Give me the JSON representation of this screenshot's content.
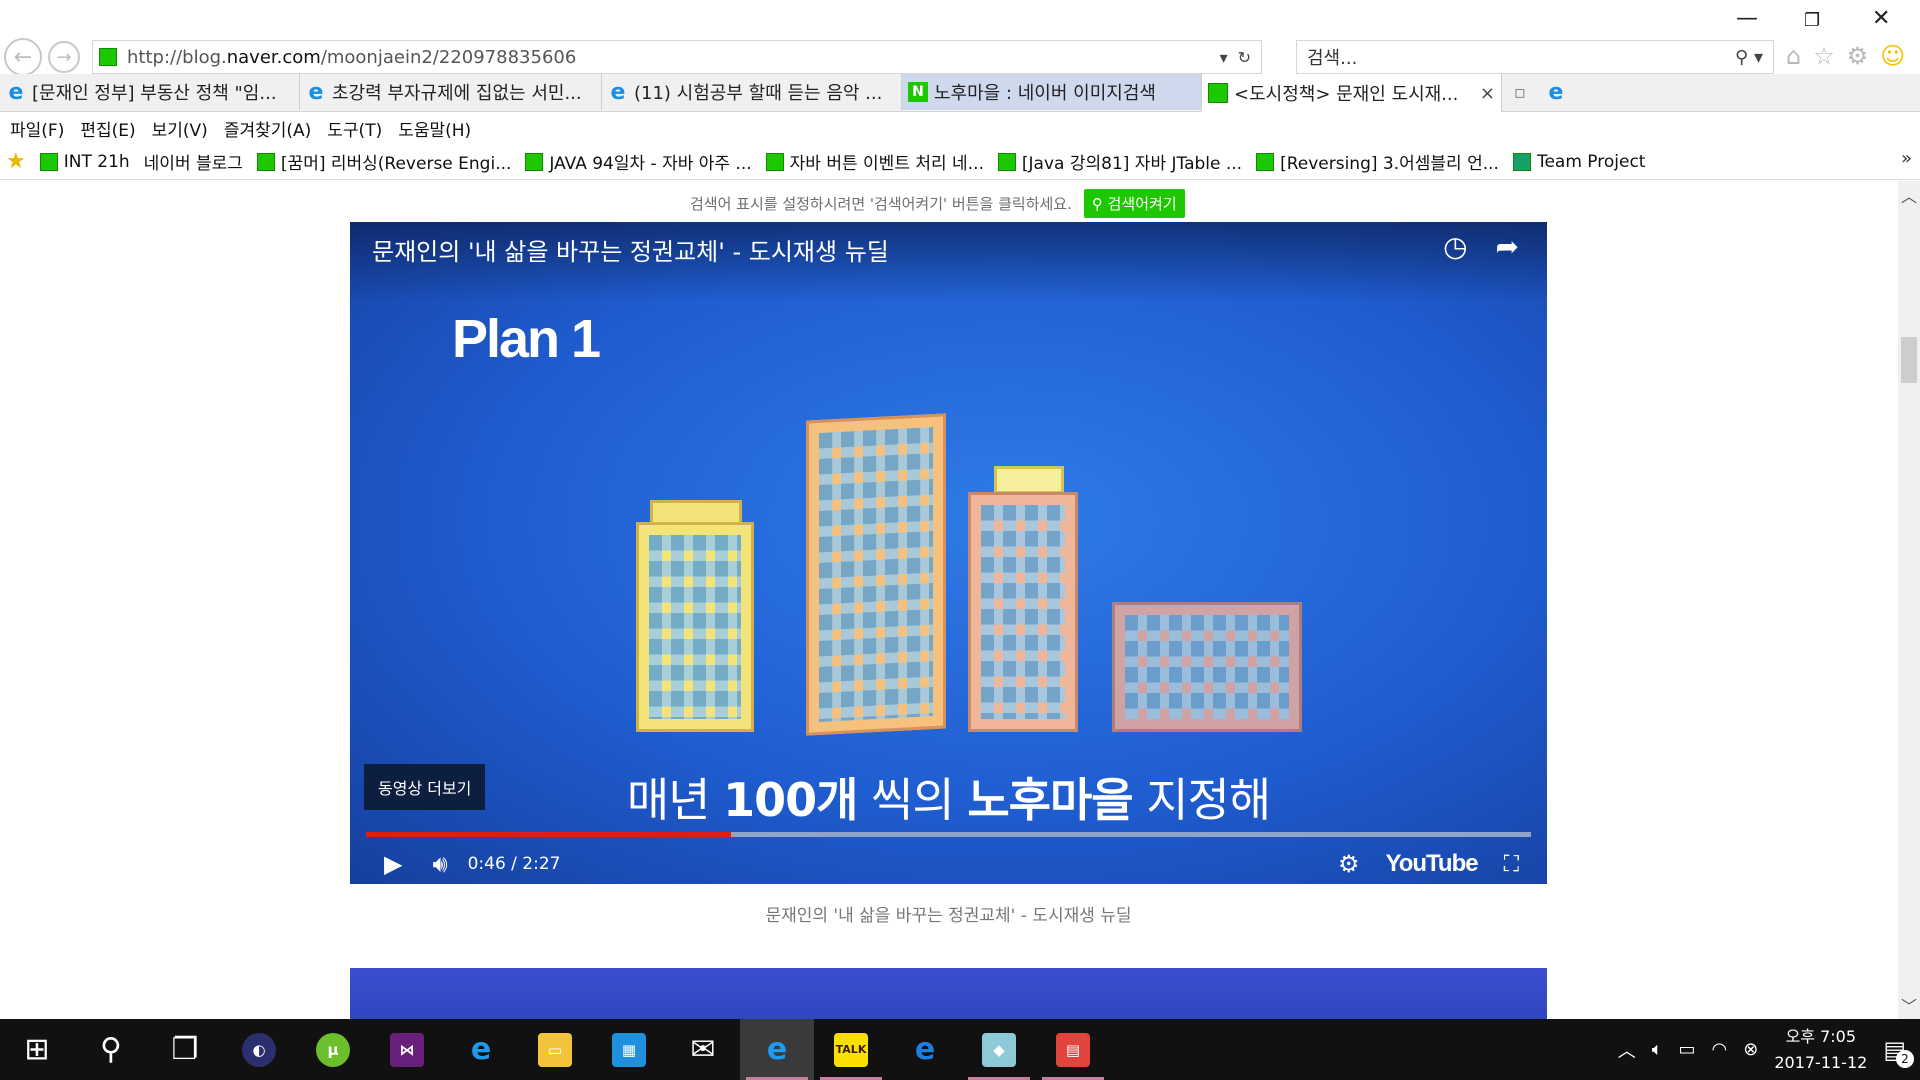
{
  "browser": {
    "address": {
      "prefix": "http://blog.",
      "domain": "naver.com",
      "path": "/moonjaein2/220978835606"
    },
    "search_placeholder": "검색...",
    "tabs": [
      {
        "label": "[문재인 정부] 부동산 정책 \"임..."
      },
      {
        "label": "초강력 부자규제에 집없는 서민..."
      },
      {
        "label": "(11) 시험공부 할때 듣는 음악 ..."
      },
      {
        "label": "노후마을 : 네이버 이미지검색"
      },
      {
        "label": "<도시정책> 문재인 도시재..."
      }
    ],
    "menu": [
      "파일(F)",
      "편집(E)",
      "보기(V)",
      "즐겨찾기(A)",
      "도구(T)",
      "도움말(H)"
    ],
    "favorites": [
      {
        "label": "INT 21h"
      },
      {
        "label": "네이버 블로그"
      },
      {
        "label": "[꿈머] 리버싱(Reverse Engi..."
      },
      {
        "label": "JAVA 94일차 - 자바 아주 ..."
      },
      {
        "label": "자바 버튼 이벤트 처리 네..."
      },
      {
        "label": "[Java 강의81] 자바 JTable ..."
      },
      {
        "label": "[Reversing] 3.어셈블리 언..."
      },
      {
        "label": "Team Project"
      }
    ]
  },
  "page": {
    "notice_text": "검색어 표시를 설정하시려면 '검색어켜기' 버튼을 클릭하세요.",
    "notice_button": "검색어켜기",
    "video": {
      "title": "문재인의 '내 삶을 바꾸는 정권교체' - 도시재생 뉴딜",
      "plan_text": "Plan 1",
      "subtitle_pre": "매년 ",
      "subtitle_bold1": "100개",
      "subtitle_mid": " 씩의 ",
      "subtitle_bold2": "노후마을",
      "subtitle_post": " 지정해",
      "more_button": "동영상 더보기",
      "time": "0:46 / 2:27",
      "progress_fraction": 0.313,
      "brand": "YouTube"
    },
    "caption": "문재인의 '내 삶을 바꾸는 정권교체' - 도시재생 뉴딜"
  },
  "taskbar": {
    "clock_time": "오후 7:05",
    "clock_date": "2017-11-12",
    "notification_count": "2",
    "kakao_label": "TALK"
  }
}
